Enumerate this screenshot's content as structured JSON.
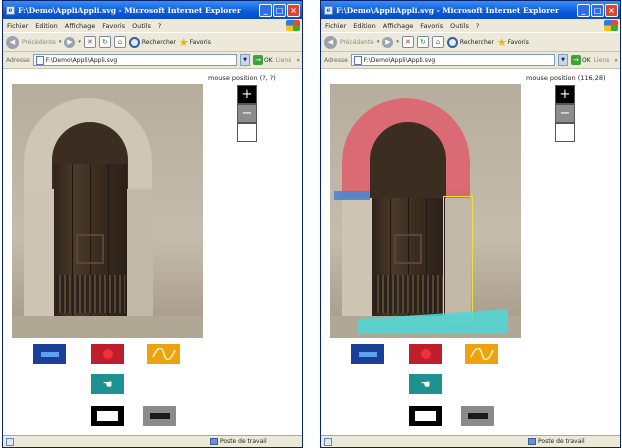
{
  "windows": [
    {
      "title": "F:\\Demo\\AppliAppli.svg - Microsoft Internet Explorer",
      "menu": [
        "Fichier",
        "Edition",
        "Affichage",
        "Favoris",
        "Outils",
        "?"
      ],
      "toolbar": {
        "back_label": "Précédente",
        "search_label": "Rechercher",
        "favorites_label": "Favoris"
      },
      "address": {
        "label": "Adresse",
        "value": "F:\\Demo\\Appli\\Appli.svg",
        "go_label": "OK",
        "links_label": "Liens"
      },
      "mouse_position": "mouse position (?, ?)",
      "highlighted": false,
      "status_zone": "Poste de travail"
    },
    {
      "title": "F:\\Demo\\AppliAppli.svg - Microsoft Internet Explorer",
      "menu": [
        "Fichier",
        "Edition",
        "Affichage",
        "Favoris",
        "Outils",
        "?"
      ],
      "toolbar": {
        "back_label": "Précédente",
        "search_label": "Rechercher",
        "favorites_label": "Favoris"
      },
      "address": {
        "label": "Adresse",
        "value": "F:\\Demo\\Appli\\Appli.svg",
        "go_label": "OK",
        "links_label": "Liens"
      },
      "mouse_position": "mouse position (116,28)",
      "highlighted": true,
      "status_zone": "Poste de travail"
    }
  ],
  "icons": {
    "zoom_in": "+",
    "zoom_out": "−",
    "hand": "☚"
  },
  "colors": {
    "titlebar": "#0a5ad8",
    "highlight_arch": "#dc5a68",
    "highlight_blue": "#4d86cc",
    "highlight_yellow": "#f2dd3a",
    "highlight_cyan": "#4fd6d6",
    "tool_rect": "#1b3e99",
    "tool_circle": "#be1f2c",
    "tool_curve": "#eea212",
    "tool_cursor": "#1e9292"
  }
}
